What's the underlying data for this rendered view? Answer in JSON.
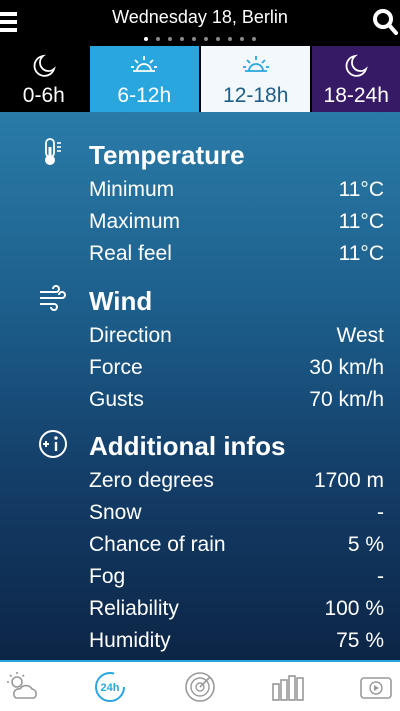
{
  "header": {
    "title": "Wednesday 18, Berlin"
  },
  "pager": {
    "count": 10,
    "active_index": 0
  },
  "tabs": [
    {
      "label": "0-6h",
      "icon": "moon-icon"
    },
    {
      "label": "6-12h",
      "icon": "sun-icon"
    },
    {
      "label": "12-18h",
      "icon": "sun-icon"
    },
    {
      "label": "18-24h",
      "icon": "moon-icon"
    }
  ],
  "temperature": {
    "title": "Temperature",
    "rows": [
      {
        "label": "Minimum",
        "value": "11°C"
      },
      {
        "label": "Maximum",
        "value": "11°C"
      },
      {
        "label": "Real feel",
        "value": "11°C"
      }
    ]
  },
  "wind": {
    "title": "Wind",
    "rows": [
      {
        "label": "Direction",
        "value": "West"
      },
      {
        "label": "Force",
        "value": "30 km/h"
      },
      {
        "label": "Gusts",
        "value": "70 km/h"
      }
    ]
  },
  "additional": {
    "title": "Additional infos",
    "rows": [
      {
        "label": "Zero degrees",
        "value": "1700 m"
      },
      {
        "label": "Snow",
        "value": "-"
      },
      {
        "label": "Chance of rain",
        "value": "5 %"
      },
      {
        "label": "Fog",
        "value": "-"
      },
      {
        "label": "Reliability",
        "value": "100 %"
      },
      {
        "label": "Humidity",
        "value": "75 %"
      }
    ]
  },
  "bottom_nav": {
    "items": [
      "weather-icon",
      "24h-icon",
      "radar-icon",
      "bar-chart-icon",
      "video-icon"
    ],
    "icon_24h_text": "24h"
  },
  "colors": {
    "accent": "#2aa6df",
    "night_tab": "#371a66",
    "selected_tab_text": "#1d5f8a"
  }
}
